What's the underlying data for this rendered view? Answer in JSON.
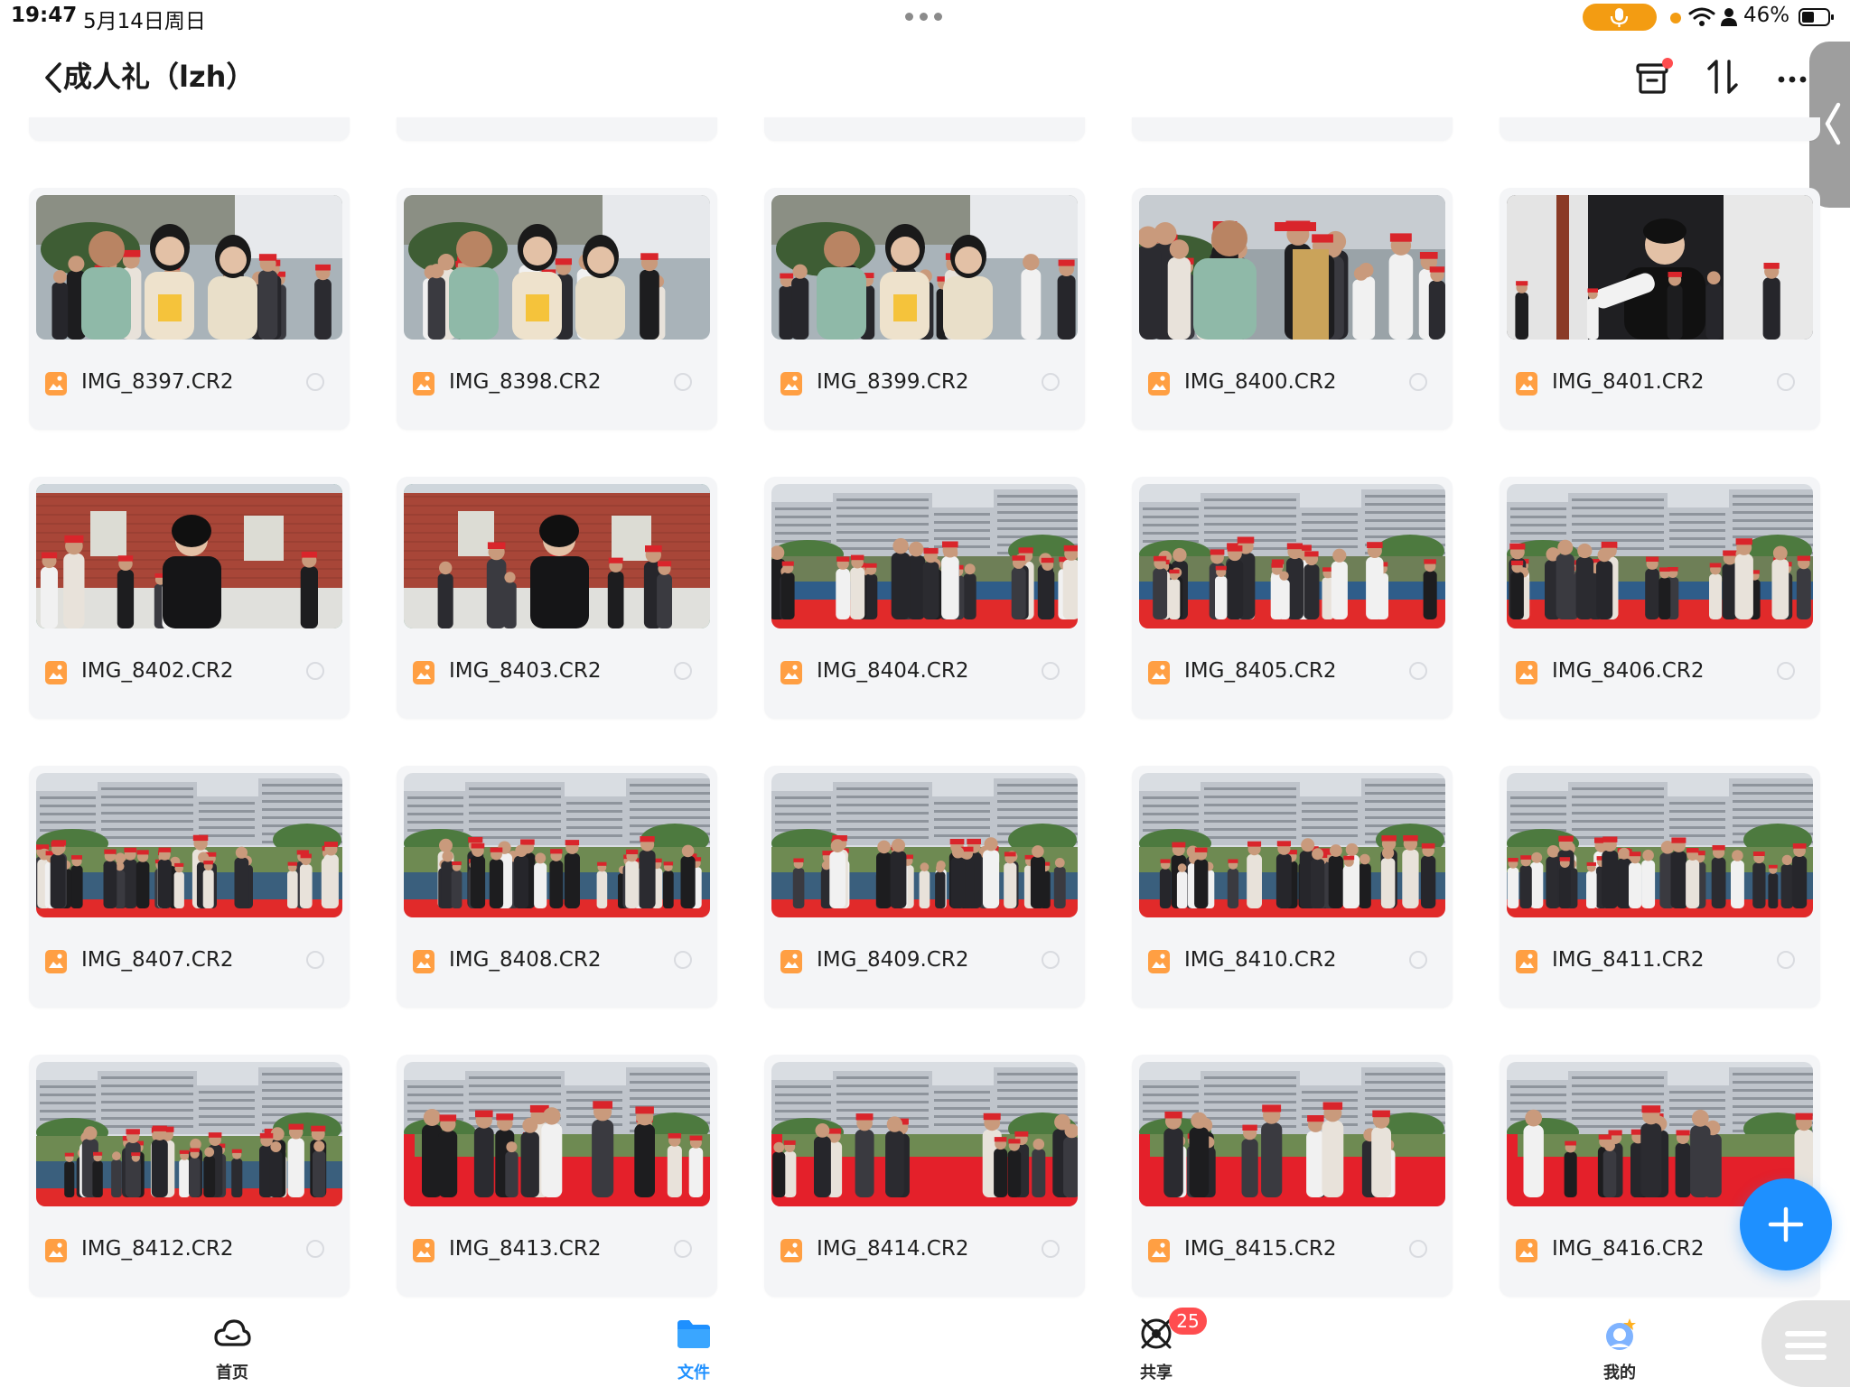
{
  "status_bar": {
    "time": "19:47",
    "date": "5月14日周日",
    "battery": "46%"
  },
  "header": {
    "title": "成人礼（lzh）",
    "icons": [
      "back-icon",
      "archive-icon",
      "sort-icon",
      "more-icon"
    ]
  },
  "colors": {
    "accent": "#1e90ff",
    "badge": "#ff4d4f",
    "card_bg": "#f4f5f7",
    "file_icon": "#ff9f43",
    "status_orange": "#f39c12"
  },
  "files": [
    {
      "name": "IMG_8397.CR2",
      "scene": "portrait"
    },
    {
      "name": "IMG_8398.CR2",
      "scene": "portrait"
    },
    {
      "name": "IMG_8399.CR2",
      "scene": "portrait"
    },
    {
      "name": "IMG_8400.CR2",
      "scene": "crowd"
    },
    {
      "name": "IMG_8401.CR2",
      "scene": "indoor"
    },
    {
      "name": "IMG_8402.CR2",
      "scene": "wall"
    },
    {
      "name": "IMG_8403.CR2",
      "scene": "wall"
    },
    {
      "name": "IMG_8404.CR2",
      "scene": "track"
    },
    {
      "name": "IMG_8405.CR2",
      "scene": "track"
    },
    {
      "name": "IMG_8406.CR2",
      "scene": "track"
    },
    {
      "name": "IMG_8407.CR2",
      "scene": "field"
    },
    {
      "name": "IMG_8408.CR2",
      "scene": "field"
    },
    {
      "name": "IMG_8409.CR2",
      "scene": "field"
    },
    {
      "name": "IMG_8410.CR2",
      "scene": "field"
    },
    {
      "name": "IMG_8411.CR2",
      "scene": "field"
    },
    {
      "name": "IMG_8412.CR2",
      "scene": "field"
    },
    {
      "name": "IMG_8413.CR2",
      "scene": "carpet"
    },
    {
      "name": "IMG_8414.CR2",
      "scene": "carpet"
    },
    {
      "name": "IMG_8415.CR2",
      "scene": "carpet"
    },
    {
      "name": "IMG_8416.CR2",
      "scene": "carpet"
    }
  ],
  "nav": {
    "home": "首页",
    "files": "文件",
    "share": "共享",
    "share_badge": "25",
    "mine": "我的"
  }
}
